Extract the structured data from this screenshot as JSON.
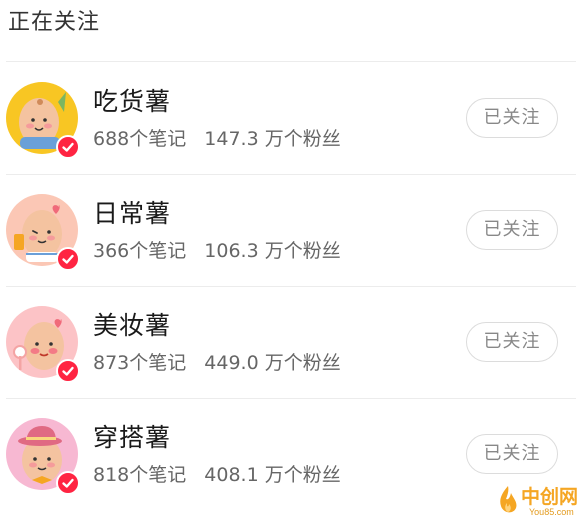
{
  "header": {
    "title": "正在关注"
  },
  "accounts": [
    {
      "name": "吃货薯",
      "notes": "688个笔记",
      "fans": "147.3 万个粉丝",
      "button": "已关注",
      "avatar_bg": "#f8c623",
      "avatar_icon": "potato-mascot-food-icon"
    },
    {
      "name": "日常薯",
      "notes": "366个笔记",
      "fans": "106.3 万个粉丝",
      "button": "已关注",
      "avatar_bg": "#fbc7b5",
      "avatar_icon": "potato-mascot-daily-icon"
    },
    {
      "name": "美妆薯",
      "notes": "873个笔记",
      "fans": "449.0 万个粉丝",
      "button": "已关注",
      "avatar_bg": "#fcc3c6",
      "avatar_icon": "potato-mascot-makeup-icon"
    },
    {
      "name": "穿搭薯",
      "notes": "818个笔记",
      "fans": "408.1 万个粉丝",
      "button": "已关注",
      "avatar_bg": "#f7b8d2",
      "avatar_icon": "potato-mascot-outfit-icon"
    }
  ],
  "verified_color": "#ff2442",
  "watermark": {
    "title": "中创网",
    "subtitle": "You85.com"
  }
}
